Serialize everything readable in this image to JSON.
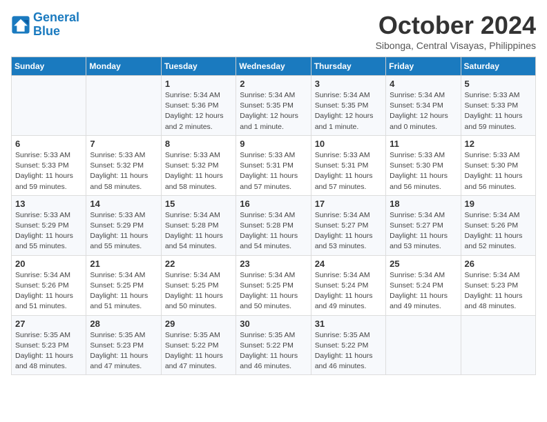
{
  "logo": {
    "line1": "General",
    "line2": "Blue"
  },
  "title": "October 2024",
  "location": "Sibonga, Central Visayas, Philippines",
  "days_of_week": [
    "Sunday",
    "Monday",
    "Tuesday",
    "Wednesday",
    "Thursday",
    "Friday",
    "Saturday"
  ],
  "weeks": [
    [
      {
        "day": "",
        "detail": ""
      },
      {
        "day": "",
        "detail": ""
      },
      {
        "day": "1",
        "detail": "Sunrise: 5:34 AM\nSunset: 5:36 PM\nDaylight: 12 hours\nand 2 minutes."
      },
      {
        "day": "2",
        "detail": "Sunrise: 5:34 AM\nSunset: 5:35 PM\nDaylight: 12 hours\nand 1 minute."
      },
      {
        "day": "3",
        "detail": "Sunrise: 5:34 AM\nSunset: 5:35 PM\nDaylight: 12 hours\nand 1 minute."
      },
      {
        "day": "4",
        "detail": "Sunrise: 5:34 AM\nSunset: 5:34 PM\nDaylight: 12 hours\nand 0 minutes."
      },
      {
        "day": "5",
        "detail": "Sunrise: 5:33 AM\nSunset: 5:33 PM\nDaylight: 11 hours\nand 59 minutes."
      }
    ],
    [
      {
        "day": "6",
        "detail": "Sunrise: 5:33 AM\nSunset: 5:33 PM\nDaylight: 11 hours\nand 59 minutes."
      },
      {
        "day": "7",
        "detail": "Sunrise: 5:33 AM\nSunset: 5:32 PM\nDaylight: 11 hours\nand 58 minutes."
      },
      {
        "day": "8",
        "detail": "Sunrise: 5:33 AM\nSunset: 5:32 PM\nDaylight: 11 hours\nand 58 minutes."
      },
      {
        "day": "9",
        "detail": "Sunrise: 5:33 AM\nSunset: 5:31 PM\nDaylight: 11 hours\nand 57 minutes."
      },
      {
        "day": "10",
        "detail": "Sunrise: 5:33 AM\nSunset: 5:31 PM\nDaylight: 11 hours\nand 57 minutes."
      },
      {
        "day": "11",
        "detail": "Sunrise: 5:33 AM\nSunset: 5:30 PM\nDaylight: 11 hours\nand 56 minutes."
      },
      {
        "day": "12",
        "detail": "Sunrise: 5:33 AM\nSunset: 5:30 PM\nDaylight: 11 hours\nand 56 minutes."
      }
    ],
    [
      {
        "day": "13",
        "detail": "Sunrise: 5:33 AM\nSunset: 5:29 PM\nDaylight: 11 hours\nand 55 minutes."
      },
      {
        "day": "14",
        "detail": "Sunrise: 5:33 AM\nSunset: 5:29 PM\nDaylight: 11 hours\nand 55 minutes."
      },
      {
        "day": "15",
        "detail": "Sunrise: 5:34 AM\nSunset: 5:28 PM\nDaylight: 11 hours\nand 54 minutes."
      },
      {
        "day": "16",
        "detail": "Sunrise: 5:34 AM\nSunset: 5:28 PM\nDaylight: 11 hours\nand 54 minutes."
      },
      {
        "day": "17",
        "detail": "Sunrise: 5:34 AM\nSunset: 5:27 PM\nDaylight: 11 hours\nand 53 minutes."
      },
      {
        "day": "18",
        "detail": "Sunrise: 5:34 AM\nSunset: 5:27 PM\nDaylight: 11 hours\nand 53 minutes."
      },
      {
        "day": "19",
        "detail": "Sunrise: 5:34 AM\nSunset: 5:26 PM\nDaylight: 11 hours\nand 52 minutes."
      }
    ],
    [
      {
        "day": "20",
        "detail": "Sunrise: 5:34 AM\nSunset: 5:26 PM\nDaylight: 11 hours\nand 51 minutes."
      },
      {
        "day": "21",
        "detail": "Sunrise: 5:34 AM\nSunset: 5:25 PM\nDaylight: 11 hours\nand 51 minutes."
      },
      {
        "day": "22",
        "detail": "Sunrise: 5:34 AM\nSunset: 5:25 PM\nDaylight: 11 hours\nand 50 minutes."
      },
      {
        "day": "23",
        "detail": "Sunrise: 5:34 AM\nSunset: 5:25 PM\nDaylight: 11 hours\nand 50 minutes."
      },
      {
        "day": "24",
        "detail": "Sunrise: 5:34 AM\nSunset: 5:24 PM\nDaylight: 11 hours\nand 49 minutes."
      },
      {
        "day": "25",
        "detail": "Sunrise: 5:34 AM\nSunset: 5:24 PM\nDaylight: 11 hours\nand 49 minutes."
      },
      {
        "day": "26",
        "detail": "Sunrise: 5:34 AM\nSunset: 5:23 PM\nDaylight: 11 hours\nand 48 minutes."
      }
    ],
    [
      {
        "day": "27",
        "detail": "Sunrise: 5:35 AM\nSunset: 5:23 PM\nDaylight: 11 hours\nand 48 minutes."
      },
      {
        "day": "28",
        "detail": "Sunrise: 5:35 AM\nSunset: 5:23 PM\nDaylight: 11 hours\nand 47 minutes."
      },
      {
        "day": "29",
        "detail": "Sunrise: 5:35 AM\nSunset: 5:22 PM\nDaylight: 11 hours\nand 47 minutes."
      },
      {
        "day": "30",
        "detail": "Sunrise: 5:35 AM\nSunset: 5:22 PM\nDaylight: 11 hours\nand 46 minutes."
      },
      {
        "day": "31",
        "detail": "Sunrise: 5:35 AM\nSunset: 5:22 PM\nDaylight: 11 hours\nand 46 minutes."
      },
      {
        "day": "",
        "detail": ""
      },
      {
        "day": "",
        "detail": ""
      }
    ]
  ]
}
